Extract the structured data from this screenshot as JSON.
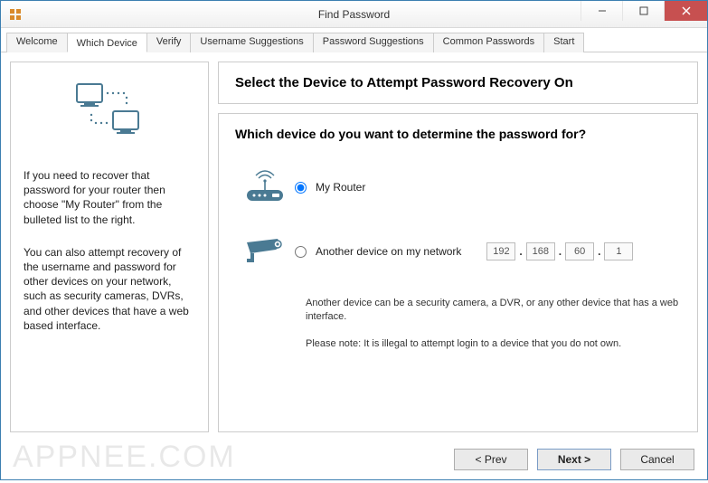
{
  "window": {
    "title": "Find Password"
  },
  "tabs": [
    {
      "label": "Welcome"
    },
    {
      "label": "Which Device"
    },
    {
      "label": "Verify"
    },
    {
      "label": "Username Suggestions"
    },
    {
      "label": "Password Suggestions"
    },
    {
      "label": "Common Passwords"
    },
    {
      "label": "Start"
    }
  ],
  "left": {
    "p1": "If you need to recover that password for your router then choose \"My Router\" from the bulleted list to the right.",
    "p2": "You can also attempt recovery of the username and password for other devices on your network, such as security cameras, DVRs, and other devices that have a web based interface."
  },
  "main": {
    "heading": "Select the Device to Attempt Password Recovery On",
    "subheading": "Which device do you want to determine the password for?",
    "option_router": "My Router",
    "option_other": "Another device on my network",
    "ip": {
      "a": "192",
      "b": "168",
      "c": "60",
      "d": "1"
    },
    "note1": "Another device can be a security camera, a DVR, or any other device that has a web interface.",
    "note2": "Please note: It is illegal to attempt login to a device that you do not own."
  },
  "footer": {
    "prev": "< Prev",
    "next": "Next >",
    "cancel": "Cancel"
  },
  "watermark": "APPNEE.COM"
}
